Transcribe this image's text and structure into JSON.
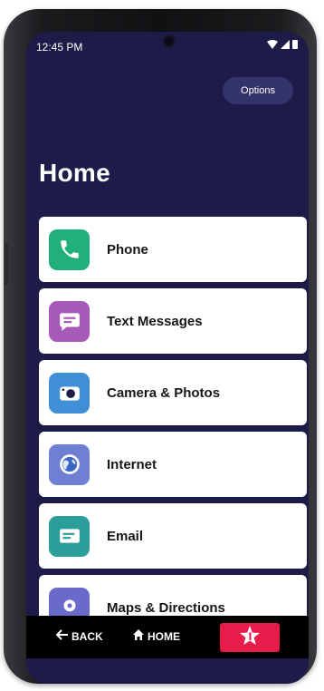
{
  "status_bar": {
    "time": "12:45 PM"
  },
  "options_label": "Options",
  "page_title": "Home",
  "menu_items": [
    {
      "label": "Phone",
      "icon": "phone-icon",
      "color": "#21b07a"
    },
    {
      "label": "Text Messages",
      "icon": "message-icon",
      "color": "#a85ab8"
    },
    {
      "label": "Camera & Photos",
      "icon": "camera-icon",
      "color": "#3f8fd6"
    },
    {
      "label": "Internet",
      "icon": "globe-icon",
      "color": "#6f7fd4"
    },
    {
      "label": "Email",
      "icon": "email-icon",
      "color": "#2b9e9a"
    },
    {
      "label": "Maps & Directions",
      "icon": "map-icon",
      "color": "#6a6acb"
    }
  ],
  "nav": {
    "back_label": "BACK",
    "home_label": "HOME",
    "urgent_icon": "urgent-response-star-icon"
  },
  "colors": {
    "screen_bg": "#1d1c49",
    "urgent": "#e71c4b",
    "options_bg": "#35346a"
  }
}
